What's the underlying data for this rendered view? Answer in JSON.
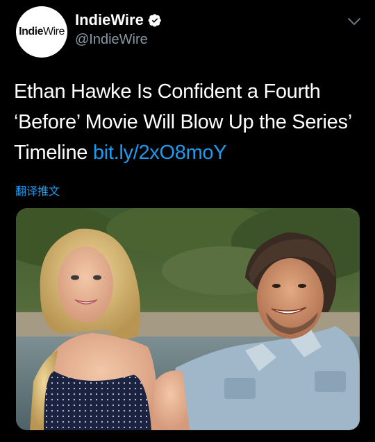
{
  "author": {
    "avatar_logo_bold": "Indie",
    "avatar_logo_light": "Wire",
    "display_name": "IndieWire",
    "handle": "@IndieWire",
    "verified": true
  },
  "tweet": {
    "text": "Ethan Hawke Is Confident a Fourth ‘Before’ Movie Will Blow Up the Series’ Timeline ",
    "link": "bit.ly/2xO8moY",
    "translate_label": "翻译推文"
  },
  "media": {
    "alt": "Photo of a woman and a man smiling outdoors by the sea",
    "type": "photo"
  },
  "colors": {
    "background": "#000000",
    "link": "#1d9bf0",
    "secondary_text": "#8b98a5",
    "verified_badge": "#ffffff"
  },
  "icons": {
    "verified": "verified-badge-icon",
    "menu": "chevron-down-icon"
  }
}
